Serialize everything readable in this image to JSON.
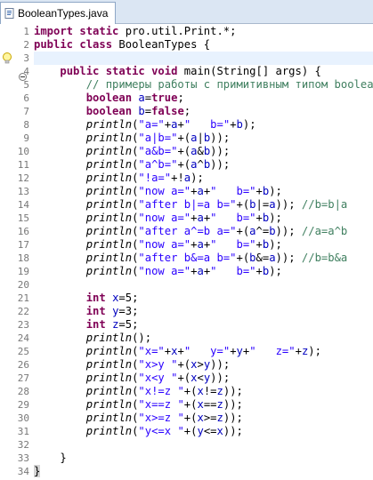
{
  "tab": {
    "title": "BooleanTypes.java"
  },
  "line_numbers": [
    "1",
    "2",
    "3",
    "4",
    "5",
    "6",
    "7",
    "8",
    "9",
    "10",
    "11",
    "12",
    "13",
    "14",
    "15",
    "16",
    "17",
    "18",
    "19",
    "20",
    "21",
    "22",
    "23",
    "24",
    "25",
    "26",
    "27",
    "28",
    "29",
    "30",
    "31",
    "32",
    "33",
    "34"
  ],
  "code": {
    "l1": [
      "import static ",
      "pro.util.Print.*;"
    ],
    "l2": [
      "public class ",
      "BooleanTypes {"
    ],
    "l4": [
      "public static void ",
      "main(String[] args) {"
    ],
    "l5": "// примеры работы с примитивным типом boolean",
    "l6": [
      "boolean ",
      "a",
      "=",
      "true",
      ";"
    ],
    "l7": [
      "boolean ",
      "b",
      "=",
      "false",
      ";"
    ],
    "l8": [
      "println",
      "(",
      "\"a=\"",
      "+",
      "a",
      "+",
      "\"   b=\"",
      "+",
      "b",
      ");"
    ],
    "l9": [
      "println",
      "(",
      "\"a|b=\"",
      "+(",
      "a",
      "|",
      "b",
      "));"
    ],
    "l10": [
      "println",
      "(",
      "\"a&b=\"",
      "+(",
      "a",
      "&",
      "b",
      "));"
    ],
    "l11": [
      "println",
      "(",
      "\"a^b=\"",
      "+(",
      "a",
      "^",
      "b",
      "));"
    ],
    "l12": [
      "println",
      "(",
      "\"!a=\"",
      "+!",
      "a",
      ");"
    ],
    "l13": [
      "println",
      "(",
      "\"now a=\"",
      "+",
      "a",
      "+",
      "\"   b=\"",
      "+",
      "b",
      ");"
    ],
    "l14": [
      "println",
      "(",
      "\"after b|=a b=\"",
      "+(",
      "b",
      "|=",
      "a",
      ")); ",
      "//b=b|a"
    ],
    "l15": [
      "println",
      "(",
      "\"now a=\"",
      "+",
      "a",
      "+",
      "\"   b=\"",
      "+",
      "b",
      ");"
    ],
    "l16": [
      "println",
      "(",
      "\"after a^=b a=\"",
      "+(",
      "a",
      "^=",
      "b",
      ")); ",
      "//a=a^b"
    ],
    "l17": [
      "println",
      "(",
      "\"now a=\"",
      "+",
      "a",
      "+",
      "\"   b=\"",
      "+",
      "b",
      ");"
    ],
    "l18": [
      "println",
      "(",
      "\"after b&=a b=\"",
      "+(",
      "b",
      "&=",
      "a",
      ")); ",
      "//b=b&a"
    ],
    "l19": [
      "println",
      "(",
      "\"now a=\"",
      "+",
      "a",
      "+",
      "\"   b=\"",
      "+",
      "b",
      ");"
    ],
    "l21": [
      "int ",
      "x",
      "=5;"
    ],
    "l22": [
      "int ",
      "y",
      "=3;"
    ],
    "l23": [
      "int ",
      "z",
      "=5;"
    ],
    "l24": [
      "println",
      "();"
    ],
    "l25": [
      "println",
      "(",
      "\"x=\"",
      "+",
      "x",
      "+",
      "\"   y=\"",
      "+",
      "y",
      "+",
      "\"   z=\"",
      "+",
      "z",
      ");"
    ],
    "l26": [
      "println",
      "(",
      "\"x>y \"",
      "+(",
      "x",
      ">",
      "y",
      "));"
    ],
    "l27": [
      "println",
      "(",
      "\"x<y \"",
      "+(",
      "x",
      "<",
      "y",
      "));"
    ],
    "l28": [
      "println",
      "(",
      "\"x!=z \"",
      "+(",
      "x",
      "!=",
      "z",
      "));"
    ],
    "l29": [
      "println",
      "(",
      "\"x==z \"",
      "+(",
      "x",
      "==",
      "z",
      "));"
    ],
    "l30": [
      "println",
      "(",
      "\"x>=z \"",
      "+(",
      "x",
      ">=",
      "z",
      "));"
    ],
    "l31": [
      "println",
      "(",
      "\"y<=x \"",
      "+(",
      "y",
      "<=",
      "x",
      "));"
    ],
    "l33": "}",
    "l34": "}"
  },
  "colors": {
    "keyword": "#7f0055",
    "comment": "#3f7f5f",
    "string": "#2a00ff",
    "field": "#0000c0",
    "current_line": "#e8f2fe"
  },
  "icons": {
    "tab": "java-file-icon",
    "warning": "lightbulb-warning-icon",
    "fold": "fold-collapse-icon"
  }
}
